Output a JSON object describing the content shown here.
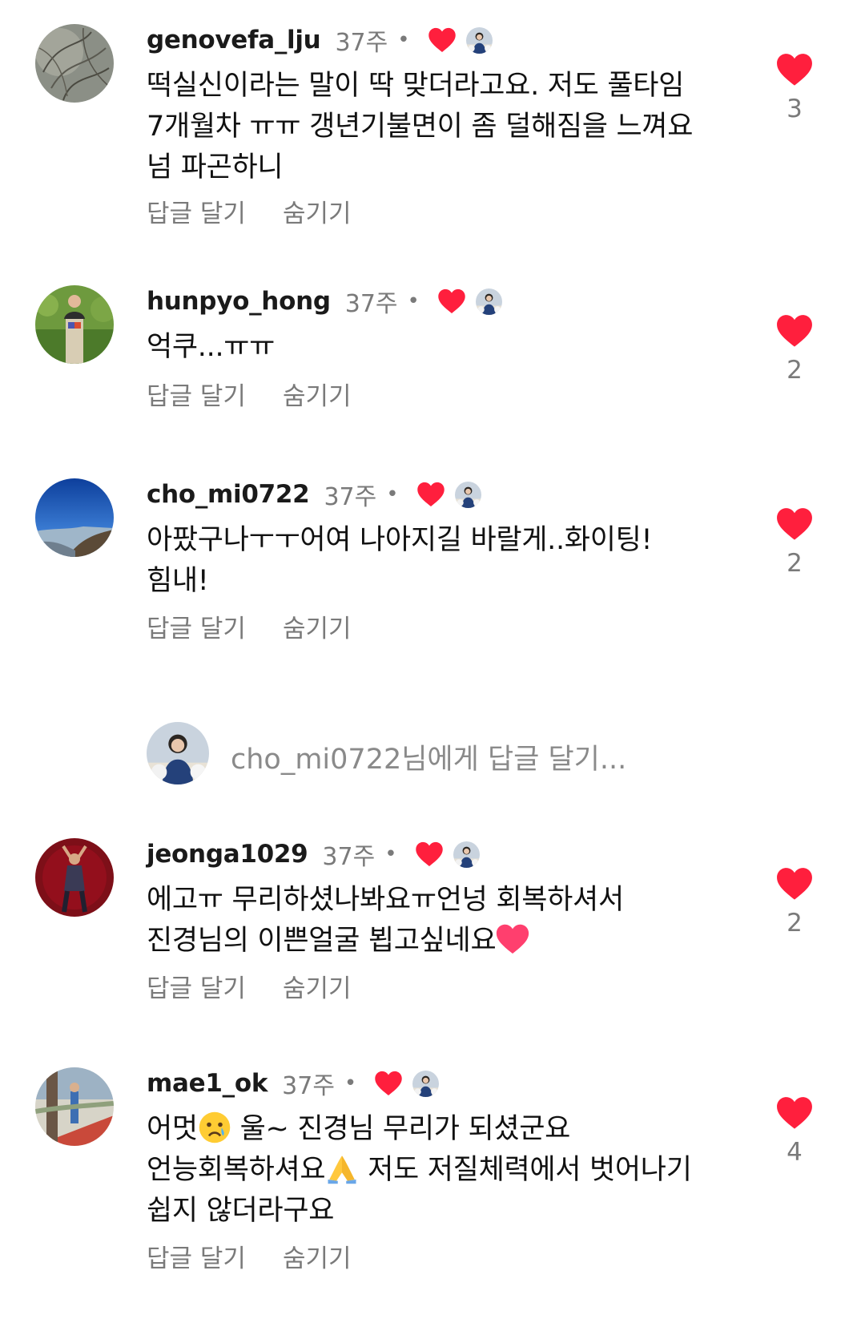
{
  "colors": {
    "heart": "#ff1f3d",
    "muted_text": "#7a7a7a",
    "primary_text": "#111111"
  },
  "comments": [
    {
      "username": "genovefa_lju",
      "time": "37주",
      "dot": "•",
      "text_lines": [
        "떡실신이라는 말이 딱 맞더라고요. 저도 풀타임",
        "7개월차 ㅠㅠ 갱년기불면이 좀 덜해짐을 느껴요",
        "넘 파곤하니"
      ],
      "reply_label": "답글 달기",
      "hide_label": "숨기기",
      "like_count": "3",
      "author_liked": true
    },
    {
      "username": "hunpyo_hong",
      "time": "37주",
      "dot": "•",
      "text_lines": [
        "억쿠...ㅠㅠ"
      ],
      "reply_label": "답글 달기",
      "hide_label": "숨기기",
      "like_count": "2",
      "author_liked": true
    },
    {
      "username": "cho_mi0722",
      "time": "37주",
      "dot": "•",
      "text_lines": [
        "아팠구나ㅜㅜ어여 나아지길 바랄게..화이팅!",
        "힘내!"
      ],
      "reply_label": "답글 달기",
      "hide_label": "숨기기",
      "like_count": "2",
      "author_liked": true
    },
    {
      "username": "jeonga1029",
      "time": "37주",
      "dot": "•",
      "text_lines": [
        "에고ㅠ 무리하셨나봐요ㅠ언넝 회복하셔서",
        "진경님의 이쁜얼굴 뵙고싶네요"
      ],
      "reply_label": "답글 달기",
      "hide_label": "숨기기",
      "like_count": "2",
      "author_liked": true
    },
    {
      "username": "mae1_ok",
      "time": "37주",
      "dot": "•",
      "text_lines": [
        "어멋",
        " 울~ 진경님 무리가 되셨군요",
        "언능회복하셔요",
        " 저도 저질체력에서 벗어나기",
        "쉽지 않더라구요"
      ],
      "reply_label": "답글 달기",
      "hide_label": "숨기기",
      "like_count": "4",
      "author_liked": true
    }
  ],
  "reply_prompt": {
    "placeholder": "cho_mi0722님에게 답글 달기..."
  },
  "icons": {
    "like": "heart-icon",
    "author_like_badge": "creator-avatar-badge",
    "emoji_heart": "pink-heart-emoji",
    "emoji_crying": "crying-face-emoji",
    "emoji_pray": "folded-hands-emoji"
  }
}
